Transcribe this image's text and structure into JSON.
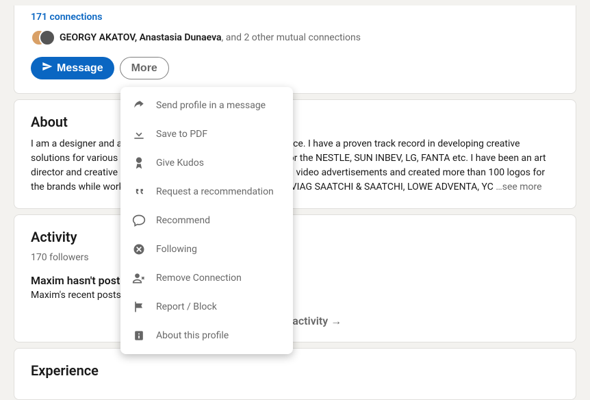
{
  "profile": {
    "connections_text": "171 connections",
    "mutual": {
      "names": "GEORGY AKATOV, Anastasia Dunaeva",
      "suffix": ", and 2 other mutual connections"
    },
    "message_label": "Message",
    "more_label": "More"
  },
  "about": {
    "heading": "About",
    "body": "I am a designer and art director with over 15 years of experience. I have a proven track record in developing creative solutions for various brands and projects. I've been working for the NESTLE, SUN INBEV, LG, FANTA etc. I have been an art director and creative director for many packaging designs and video advertisements and created more than 100 logos for the brands while working in advertising agencies such as the VIAG SAATCHI & SAATCHI, LOWE ADVENTA, YC",
    "see_more": "  …see more"
  },
  "activity": {
    "heading": "Activity",
    "followers": "170 followers",
    "no_posts_title": "Maxim hasn't posted lately",
    "no_posts_desc": "Maxim's recent posts and comments will be displayed here.",
    "show_all": "Show all activity →"
  },
  "experience": {
    "heading": "Experience"
  },
  "dropdown": {
    "items": [
      "Send profile in a message",
      "Save to PDF",
      "Give Kudos",
      "Request a recommendation",
      "Recommend",
      "Following",
      "Remove Connection",
      "Report / Block",
      "About this profile"
    ]
  }
}
